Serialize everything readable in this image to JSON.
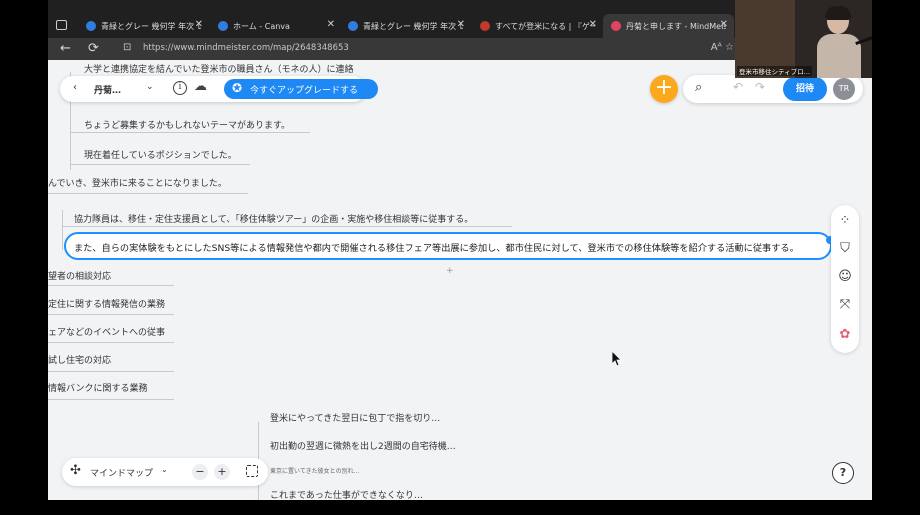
{
  "browser": {
    "tabs": [
      {
        "title": "青緑とグレー 幾何学 年次 レ",
        "favicon_color": "#2f7de1",
        "active": false
      },
      {
        "title": "ホーム - Canva",
        "favicon_color": "#2f7de1",
        "active": false
      },
      {
        "title": "青緑とグレー 幾何学 年次 レ",
        "favicon_color": "#2f7de1",
        "active": false
      },
      {
        "title": "すべてが登米になる | 『ゲーム",
        "favicon_color": "#c0392b",
        "active": false
      },
      {
        "title": "丹菊と申します - MindMeis",
        "favicon_color": "#e0445f",
        "active": true
      }
    ],
    "url": "https://www.mindmeister.com/map/2648348653",
    "tab_close_glyph": "✕",
    "nav": {
      "back": "←",
      "reload": "⟳"
    },
    "lock_glyph": "⊡",
    "addr_right": "Aᴬ  ☆"
  },
  "toolbar": {
    "back_glyph": "‹",
    "map_name": "丹菊…",
    "chevron": "⌄",
    "info_glyph": "i",
    "cloud_glyph": "☁",
    "upgrade_label": "今すぐアップグレードする",
    "star_glyph": "✪",
    "add_glyph": "+",
    "search_glyph": "⌕",
    "undo_glyph": "↶",
    "redo_glyph": "↷",
    "invite_label": "招待",
    "avatar_initials": "TR"
  },
  "mindmap": {
    "top_nodes": [
      "大学と連携協定を結んでいた登米市の職員さん（モネの人）に連絡",
      "ちょうど募集するかもしれないテーマがあります。",
      "現在着任しているポジションでした。",
      "んでいき、登米市に来ることになりました。"
    ],
    "main_node": "協力隊員は、移住・定住支援員として、「移住体験ツアー」の企画・実施や移住相談等に従事する。",
    "selected_node": "また、自らの実体験をもとにしたSNS等による情報発信や都内で開催される移住フェア等出展に参加し、都市住民に対して、登米市での移住体験等を紹介する活動に従事する。",
    "left_nodes": [
      "望者の相談対応",
      "定住に関する情報発信の業務",
      "ェアなどのイベントへの従事",
      "試し住宅の対応",
      "情報バンクに関する業務"
    ],
    "bottom_nodes": [
      "登米にやってきた翌日に包丁で指を切り…",
      "初出勤の翌週に微熱を出し2週間の自宅待機…",
      "東京に置いてきた彼女との別れ…",
      "これまであった仕事ができなくなり…"
    ],
    "plus_glyph": "+"
  },
  "side_panel": {
    "icons": [
      "shapes-icon",
      "paint-bucket-icon",
      "emoji-icon",
      "connection-icon",
      "color-icon"
    ],
    "glyphs": [
      "⁘",
      "⛉",
      "☺",
      "⤧",
      "✿"
    ]
  },
  "bottom_bar": {
    "layout_glyph": "✣",
    "layout_label": "マインドマップ",
    "layout_chev": "⌄",
    "zoom_out": "−",
    "zoom_in": "+",
    "help_glyph": "?"
  },
  "webcam": {
    "caption": "登米市移住シティプロ…"
  }
}
